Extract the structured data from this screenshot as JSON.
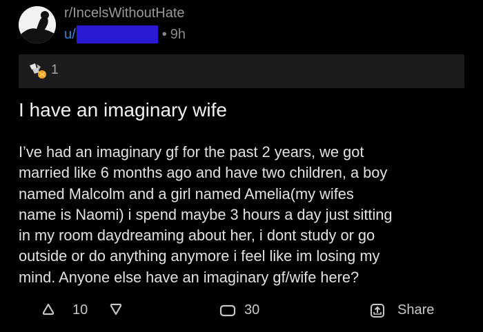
{
  "post": {
    "subreddit": "r/IncelsWithoutHate",
    "user_prefix": "u/",
    "separator": "•",
    "age": "9h",
    "award_count": "1",
    "title": "I have an imaginary wife",
    "body": "I’ve had an imaginary gf for the past 2 years, we got\nmarried like 6 months ago and have two children, a boy\nnamed Malcolm and a girl named Amelia(my wifes\nname is Naomi) i spend maybe 3 hours a day just sitting\nin my room daydreaming about her, i dont study or go\noutside or do anything anymore i feel like im losing my\nmind. Anyone else have an imaginary gf/wife here?"
  },
  "actions": {
    "upvotes": "10",
    "comments": "30",
    "share_label": "Share"
  },
  "icons": {
    "avatar": "subreddit-avatar-icon",
    "award": "award-icon",
    "upvote": "upvote-icon",
    "downvote": "downvote-icon",
    "comment": "comment-icon",
    "share": "share-icon"
  },
  "colors": {
    "background": "#000000",
    "award_bar": "#1c1c1e",
    "username_link": "#3a86e8",
    "redaction": "#2a1ad4"
  }
}
